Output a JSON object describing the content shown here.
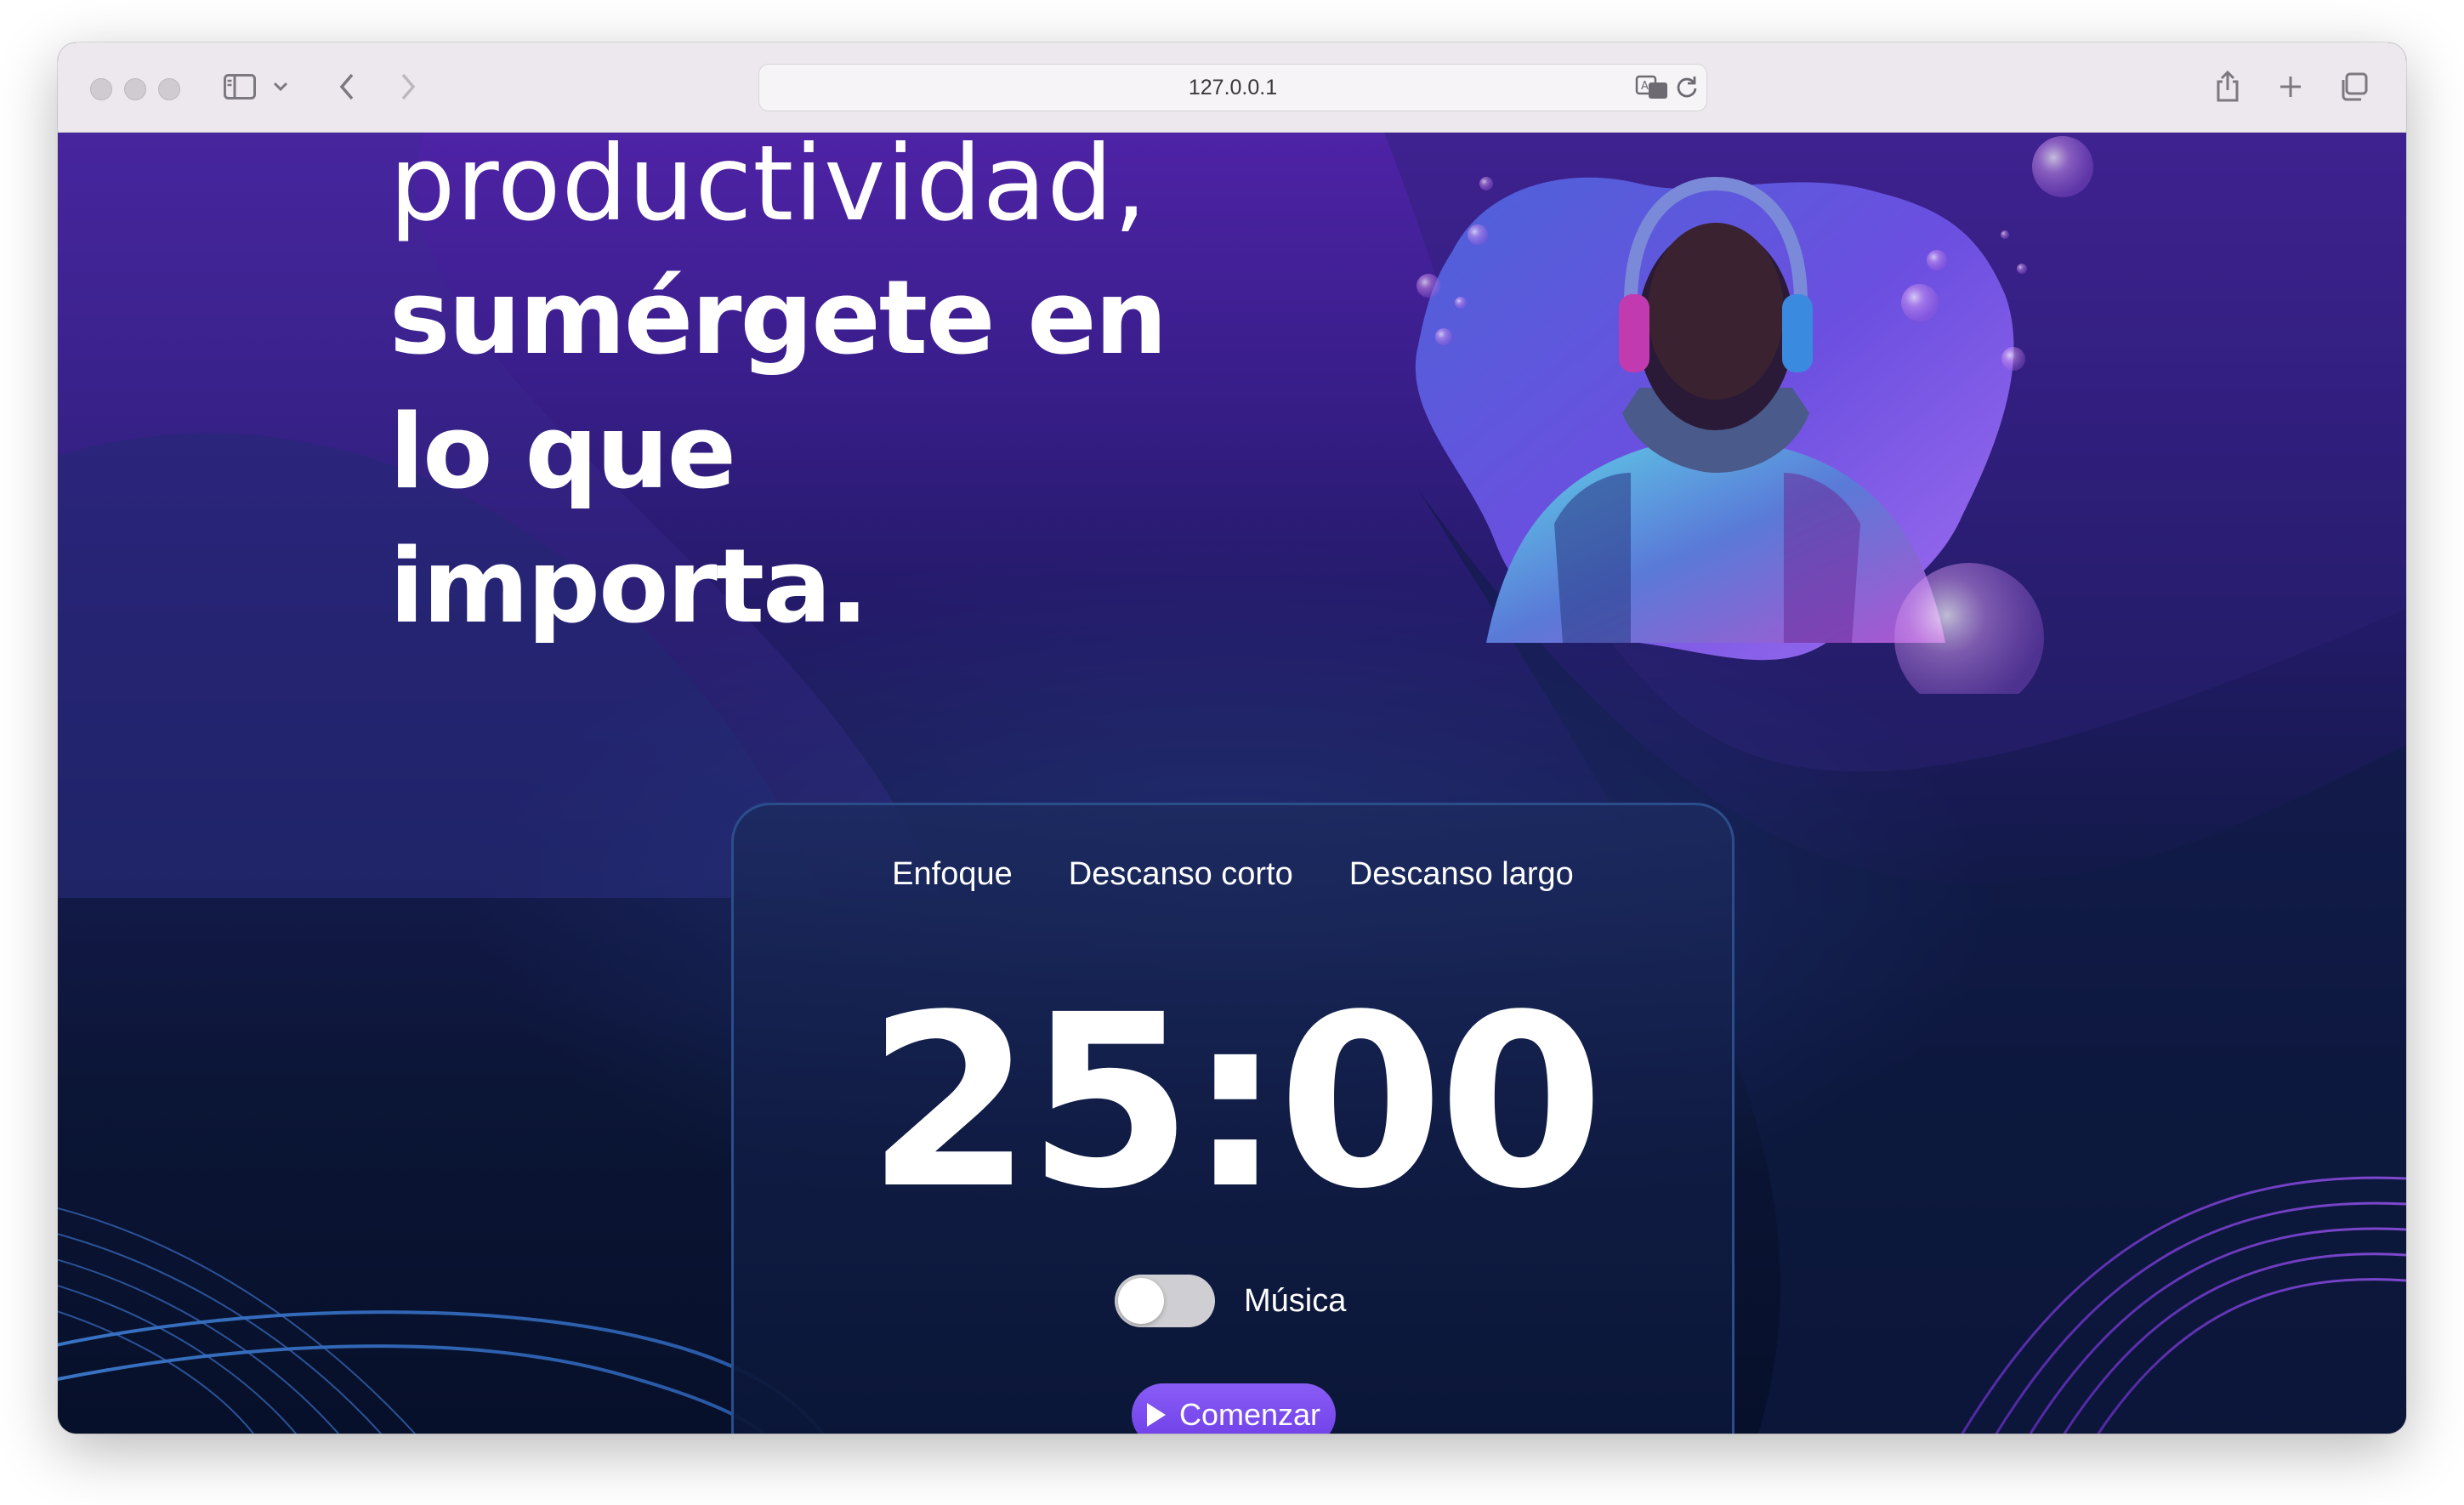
{
  "browser": {
    "url": "127.0.0.1"
  },
  "hero": {
    "line1": "productividad,",
    "line2": "sumérgete en",
    "line3": "lo que",
    "line4": "importa."
  },
  "timer": {
    "tabs": [
      "Enfoque",
      "Descanso corto",
      "Descanso largo"
    ],
    "time": "25:00",
    "music_label": "Música",
    "music_on": false,
    "start_label": "Comenzar"
  },
  "colors": {
    "accent": "#7c4ef2",
    "background_top": "#4e23a6",
    "background_bottom": "#07102a"
  }
}
